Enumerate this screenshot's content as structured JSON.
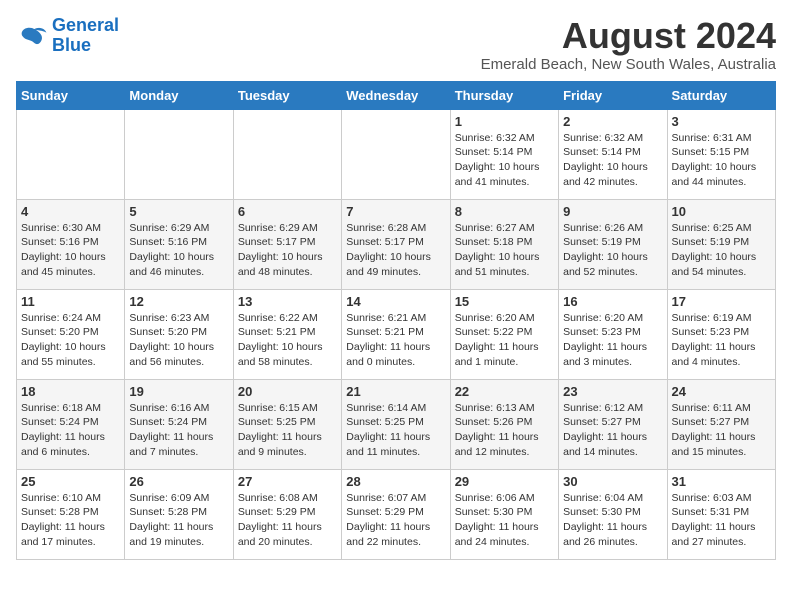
{
  "header": {
    "logo_line1": "General",
    "logo_line2": "Blue",
    "month_year": "August 2024",
    "location": "Emerald Beach, New South Wales, Australia"
  },
  "days_of_week": [
    "Sunday",
    "Monday",
    "Tuesday",
    "Wednesday",
    "Thursday",
    "Friday",
    "Saturday"
  ],
  "weeks": [
    [
      {
        "day": "",
        "info": ""
      },
      {
        "day": "",
        "info": ""
      },
      {
        "day": "",
        "info": ""
      },
      {
        "day": "",
        "info": ""
      },
      {
        "day": "1",
        "info": "Sunrise: 6:32 AM\nSunset: 5:14 PM\nDaylight: 10 hours\nand 41 minutes."
      },
      {
        "day": "2",
        "info": "Sunrise: 6:32 AM\nSunset: 5:14 PM\nDaylight: 10 hours\nand 42 minutes."
      },
      {
        "day": "3",
        "info": "Sunrise: 6:31 AM\nSunset: 5:15 PM\nDaylight: 10 hours\nand 44 minutes."
      }
    ],
    [
      {
        "day": "4",
        "info": "Sunrise: 6:30 AM\nSunset: 5:16 PM\nDaylight: 10 hours\nand 45 minutes."
      },
      {
        "day": "5",
        "info": "Sunrise: 6:29 AM\nSunset: 5:16 PM\nDaylight: 10 hours\nand 46 minutes."
      },
      {
        "day": "6",
        "info": "Sunrise: 6:29 AM\nSunset: 5:17 PM\nDaylight: 10 hours\nand 48 minutes."
      },
      {
        "day": "7",
        "info": "Sunrise: 6:28 AM\nSunset: 5:17 PM\nDaylight: 10 hours\nand 49 minutes."
      },
      {
        "day": "8",
        "info": "Sunrise: 6:27 AM\nSunset: 5:18 PM\nDaylight: 10 hours\nand 51 minutes."
      },
      {
        "day": "9",
        "info": "Sunrise: 6:26 AM\nSunset: 5:19 PM\nDaylight: 10 hours\nand 52 minutes."
      },
      {
        "day": "10",
        "info": "Sunrise: 6:25 AM\nSunset: 5:19 PM\nDaylight: 10 hours\nand 54 minutes."
      }
    ],
    [
      {
        "day": "11",
        "info": "Sunrise: 6:24 AM\nSunset: 5:20 PM\nDaylight: 10 hours\nand 55 minutes."
      },
      {
        "day": "12",
        "info": "Sunrise: 6:23 AM\nSunset: 5:20 PM\nDaylight: 10 hours\nand 56 minutes."
      },
      {
        "day": "13",
        "info": "Sunrise: 6:22 AM\nSunset: 5:21 PM\nDaylight: 10 hours\nand 58 minutes."
      },
      {
        "day": "14",
        "info": "Sunrise: 6:21 AM\nSunset: 5:21 PM\nDaylight: 11 hours\nand 0 minutes."
      },
      {
        "day": "15",
        "info": "Sunrise: 6:20 AM\nSunset: 5:22 PM\nDaylight: 11 hours\nand 1 minute."
      },
      {
        "day": "16",
        "info": "Sunrise: 6:20 AM\nSunset: 5:23 PM\nDaylight: 11 hours\nand 3 minutes."
      },
      {
        "day": "17",
        "info": "Sunrise: 6:19 AM\nSunset: 5:23 PM\nDaylight: 11 hours\nand 4 minutes."
      }
    ],
    [
      {
        "day": "18",
        "info": "Sunrise: 6:18 AM\nSunset: 5:24 PM\nDaylight: 11 hours\nand 6 minutes."
      },
      {
        "day": "19",
        "info": "Sunrise: 6:16 AM\nSunset: 5:24 PM\nDaylight: 11 hours\nand 7 minutes."
      },
      {
        "day": "20",
        "info": "Sunrise: 6:15 AM\nSunset: 5:25 PM\nDaylight: 11 hours\nand 9 minutes."
      },
      {
        "day": "21",
        "info": "Sunrise: 6:14 AM\nSunset: 5:25 PM\nDaylight: 11 hours\nand 11 minutes."
      },
      {
        "day": "22",
        "info": "Sunrise: 6:13 AM\nSunset: 5:26 PM\nDaylight: 11 hours\nand 12 minutes."
      },
      {
        "day": "23",
        "info": "Sunrise: 6:12 AM\nSunset: 5:27 PM\nDaylight: 11 hours\nand 14 minutes."
      },
      {
        "day": "24",
        "info": "Sunrise: 6:11 AM\nSunset: 5:27 PM\nDaylight: 11 hours\nand 15 minutes."
      }
    ],
    [
      {
        "day": "25",
        "info": "Sunrise: 6:10 AM\nSunset: 5:28 PM\nDaylight: 11 hours\nand 17 minutes."
      },
      {
        "day": "26",
        "info": "Sunrise: 6:09 AM\nSunset: 5:28 PM\nDaylight: 11 hours\nand 19 minutes."
      },
      {
        "day": "27",
        "info": "Sunrise: 6:08 AM\nSunset: 5:29 PM\nDaylight: 11 hours\nand 20 minutes."
      },
      {
        "day": "28",
        "info": "Sunrise: 6:07 AM\nSunset: 5:29 PM\nDaylight: 11 hours\nand 22 minutes."
      },
      {
        "day": "29",
        "info": "Sunrise: 6:06 AM\nSunset: 5:30 PM\nDaylight: 11 hours\nand 24 minutes."
      },
      {
        "day": "30",
        "info": "Sunrise: 6:04 AM\nSunset: 5:30 PM\nDaylight: 11 hours\nand 26 minutes."
      },
      {
        "day": "31",
        "info": "Sunrise: 6:03 AM\nSunset: 5:31 PM\nDaylight: 11 hours\nand 27 minutes."
      }
    ]
  ]
}
